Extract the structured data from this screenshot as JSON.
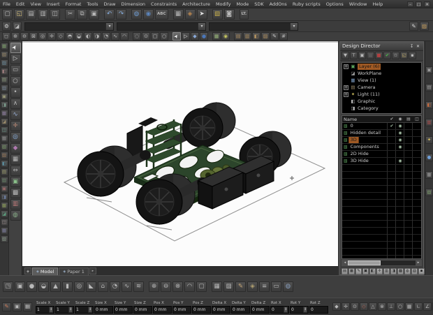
{
  "menu": {
    "items": [
      "File",
      "Edit",
      "View",
      "Insert",
      "Format",
      "Tools",
      "Draw",
      "Dimension",
      "Constraints",
      "Architecture",
      "Modify",
      "Mode",
      "SDK",
      "AddOns",
      "Ruby scripts",
      "Options",
      "Window",
      "Help"
    ]
  },
  "window_buttons": [
    {
      "n": "minimize-icon",
      "g": "–"
    },
    {
      "n": "maximize-icon",
      "g": "□"
    },
    {
      "n": "close-icon",
      "g": "✕"
    }
  ],
  "toolbar1": {
    "icons": [
      {
        "n": "new-icon",
        "g": "▢"
      },
      {
        "n": "open-icon",
        "g": "◱",
        "c": "#d8c27a"
      },
      {
        "n": "save-icon",
        "g": "▤"
      },
      {
        "n": "print-icon",
        "g": "▥"
      },
      {
        "n": "print-preview-icon",
        "g": "◫"
      },
      {
        "n": "cut-icon",
        "g": "✂",
        "sp": 1
      },
      {
        "n": "copy-icon",
        "g": "⧉"
      },
      {
        "n": "paste-icon",
        "g": "▣"
      },
      {
        "n": "undo-icon",
        "g": "↶",
        "c": "#8ab4e8",
        "sp": 1
      },
      {
        "n": "redo-icon",
        "g": "↷",
        "c": "#8ab4e8"
      },
      {
        "n": "render-icon",
        "g": "◍",
        "c": "#6f9fd8",
        "sp": 1
      },
      {
        "n": "lighting-icon",
        "g": "◉",
        "c": "#5b86c0"
      },
      {
        "n": "spell-check-icon",
        "g": "ABC",
        "cls": "wide"
      },
      {
        "n": "grid-icon",
        "g": "▦",
        "sp": 1
      },
      {
        "n": "material-icon",
        "g": "◈",
        "c": "#c08a50"
      },
      {
        "n": "pointer-icon",
        "g": "➤",
        "c": "#e8e8e8"
      },
      {
        "n": "library-icon",
        "g": "▧",
        "c": "#c8b04a",
        "sp": 1
      },
      {
        "n": "stamp-icon",
        "g": "◙"
      },
      {
        "n": "lite-mode-icon",
        "g": "LT.",
        "cls": "wide",
        "sp": 1
      }
    ]
  },
  "property_bar": {
    "combo_arrow": "▾",
    "left_icons": [
      {
        "n": "settings-gear-icon",
        "g": "⚙",
        "c": "#dcdcdc"
      },
      {
        "n": "workplane-icon",
        "g": "◪",
        "c": "#b8b8b8"
      }
    ],
    "combos": [
      {
        "n": "layer-combo",
        "value": ""
      },
      {
        "n": "pen-style-combo",
        "value": ""
      },
      {
        "n": "pen-width-combo",
        "value": ""
      }
    ],
    "right_icons": [
      {
        "n": "pen-icon",
        "g": "✎",
        "c": "#d8d8d8"
      },
      {
        "n": "material-preview-icon",
        "g": "▨",
        "c": "#c8a060"
      }
    ]
  },
  "view_toolbar": {
    "icons": [
      {
        "n": "zoom-window-icon",
        "g": "◻"
      },
      {
        "n": "zoom-in-icon",
        "g": "⊕"
      },
      {
        "n": "zoom-out-icon",
        "g": "⊖"
      },
      {
        "n": "zoom-extents-icon",
        "g": "⊠"
      },
      {
        "n": "zoom-previous-icon",
        "g": "◎"
      },
      {
        "n": "pan-icon",
        "g": "✛"
      },
      {
        "n": "view-iso-icon",
        "g": "◇"
      },
      {
        "n": "view-top-icon",
        "g": "◓"
      },
      {
        "n": "view-bottom-icon",
        "g": "◒"
      },
      {
        "n": "view-left-icon",
        "g": "◐"
      },
      {
        "n": "view-right-icon",
        "g": "◑"
      },
      {
        "n": "orbit-icon",
        "g": "◔"
      },
      {
        "n": "walk-icon",
        "g": "∿"
      },
      {
        "n": "camera-icon",
        "g": "◠"
      },
      {
        "n": "redline-icon",
        "g": "◌",
        "sp": 1
      },
      {
        "n": "markup-icon",
        "g": "⊙"
      },
      {
        "n": "frame-icon",
        "g": "▢"
      },
      {
        "n": "circle-view-icon",
        "g": "○"
      },
      {
        "n": "select-arrow-icon",
        "g": "➤",
        "c": "#ffffff",
        "cls": "hl cur",
        "sp": 1
      },
      {
        "n": "select-open-icon",
        "g": "▷",
        "c": "#e0e0e0"
      },
      {
        "n": "snap-vertex-icon",
        "g": "◆",
        "c": "#88a8d8"
      },
      {
        "n": "snap-center-icon",
        "g": "●",
        "c": "#4a76b8"
      },
      {
        "n": "snap-grid-icon",
        "g": "▦",
        "c": "#9ab87a",
        "sp": 1
      },
      {
        "n": "snap-quadrant-icon",
        "g": "◉",
        "c": "#c8c860"
      },
      {
        "n": "group-icon",
        "g": "▤",
        "c": "#b09060",
        "sp": 1
      },
      {
        "n": "explode-icon",
        "g": "▥",
        "c": "#b09060"
      },
      {
        "n": "block-icon",
        "g": "◧",
        "c": "#b09060"
      },
      {
        "n": "hatch-icon",
        "g": "▨",
        "c": "#b09060"
      },
      {
        "n": "sketch-icon",
        "g": "✎",
        "c": "#c8c8c8"
      },
      {
        "n": "measure-icon",
        "g": "#"
      }
    ]
  },
  "left_dock_a": {
    "icons": [
      {
        "g": "▦",
        "c": "#7a9a6a"
      },
      {
        "g": "▧",
        "c": "#9a8a6a"
      },
      {
        "g": "▨",
        "c": "#6a8a9a"
      },
      {
        "g": "◧",
        "c": "#9a7a7a"
      },
      {
        "g": "▤",
        "c": "#8a9a7a"
      },
      {
        "g": "▥",
        "c": "#7a8a9a"
      },
      {
        "g": "▣",
        "c": "#9a9a7a"
      },
      {
        "g": "◨",
        "c": "#7a9a8a"
      },
      {
        "g": "▩",
        "c": "#8a7a9a"
      },
      {
        "g": "◪",
        "c": "#9a8a6a"
      },
      {
        "g": "◫",
        "c": "#6a9a8a"
      },
      {
        "g": "▦",
        "c": "#8a8a8a"
      },
      {
        "g": "▧",
        "c": "#7a9a6a"
      },
      {
        "g": "▨",
        "c": "#9a7a5a"
      },
      {
        "g": "◧",
        "c": "#5a8a9a"
      },
      {
        "g": "▤",
        "c": "#9a9a6a"
      },
      {
        "g": "▥",
        "c": "#6a8a6a"
      },
      {
        "g": "▣",
        "c": "#9a6a6a"
      },
      {
        "g": "◨",
        "c": "#6a7a9a"
      },
      {
        "g": "▩",
        "c": "#8a9a5a"
      },
      {
        "g": "◪",
        "c": "#5a9a7a"
      },
      {
        "g": "◫",
        "c": "#9a8a8a"
      },
      {
        "g": "▦",
        "c": "#7a7a9a"
      },
      {
        "g": "▧",
        "c": "#8a9a8a"
      }
    ]
  },
  "left_tools": {
    "icons": [
      {
        "n": "select-tool-icon",
        "g": "➤",
        "c": "#f2f2f2",
        "cls": "hl cur"
      },
      {
        "n": "select-open-tool-icon",
        "g": "▷",
        "c": "#d8d8d8"
      },
      {
        "n": "rect-tool-icon",
        "g": "▭"
      },
      {
        "n": "circle-tool-icon",
        "g": "○"
      },
      {
        "n": "point-tool-icon",
        "g": "•"
      },
      {
        "n": "polyline-tool-icon",
        "g": "∧"
      },
      {
        "n": "spline-tool-icon",
        "g": "∿",
        "c": "#9ab0d8"
      },
      {
        "n": "pick-point-tool-icon",
        "g": "✛",
        "c": "#c8907a"
      },
      {
        "n": "orbit-tool-icon",
        "g": "◎",
        "c": "#8ab0e0"
      },
      {
        "n": "gem-tool-icon",
        "g": "◆",
        "c": "#b07ab0"
      },
      {
        "n": "grid-tool-icon",
        "g": "▦"
      },
      {
        "n": "resize-tool-icon",
        "g": "⇔"
      },
      {
        "n": "cube-tool-icon",
        "g": "▣",
        "c": "#8ac08a"
      },
      {
        "n": "pattern-tool-icon",
        "g": "▩"
      },
      {
        "n": "material-tool-icon",
        "g": "▥",
        "c": "#c07a7a"
      },
      {
        "n": "render-tool-icon",
        "g": "◍",
        "c": "#8ab08a"
      }
    ]
  },
  "right_dock": {
    "icons": [
      {
        "n": "properties-icon",
        "g": "▣",
        "c": "#9a9a9a"
      },
      {
        "n": "selection-info-icon",
        "g": "▤",
        "c": "#9a9a9a"
      },
      {
        "n": "blocks-icon",
        "g": "◧",
        "c": "#c06a40"
      },
      {
        "n": "library-palette-icon",
        "g": "▥",
        "c": "#b04a4a"
      },
      {
        "n": "lights-icon",
        "g": "✦",
        "c": "#d8c060"
      },
      {
        "n": "render-manager-icon",
        "g": "●",
        "c": "#6f9fd8"
      },
      {
        "n": "schedule-icon",
        "g": "▦",
        "c": "#9a9a9a"
      },
      {
        "n": "layers-palette-icon",
        "g": "▧",
        "c": "#7a9a6a"
      }
    ]
  },
  "design_director": {
    "title": "Design Director",
    "pin_glyph": "↧",
    "close_glyph": "✕",
    "toolbar_icons": [
      {
        "n": "dd-filter-icon",
        "g": "▼"
      },
      {
        "n": "dd-text-icon",
        "g": "T"
      },
      {
        "n": "dd-box-icon",
        "g": "▣"
      },
      {
        "n": "dd-dark-icon",
        "g": "■",
        "c": "#565656"
      },
      {
        "n": "dd-delete-icon",
        "g": "■",
        "c": "#b04040"
      },
      {
        "n": "dd-apply-check-icon",
        "g": "✔",
        "c": "#49c049"
      },
      {
        "n": "dd-blank-icon",
        "g": "▫"
      },
      {
        "n": "dd-folder-icon",
        "g": "◱",
        "c": "#d0b870"
      },
      {
        "n": "dd-props-icon",
        "g": "▪"
      }
    ],
    "tree": {
      "items": [
        {
          "exp": "+",
          "ig": "▣",
          "c": "#5aa05a",
          "label": "Layer (6)",
          "cls": "sel",
          "n": "tree-item-layer"
        },
        {
          "exp": "",
          "ig": "◪",
          "c": "#9a9a9a",
          "label": "WorkPlane",
          "n": "tree-item-workplane"
        },
        {
          "exp": "",
          "ig": "▦",
          "c": "#7a9ac0",
          "label": "View (1)",
          "n": "tree-item-view"
        },
        {
          "exp": "+",
          "ig": "▤",
          "c": "#9a8a6a",
          "label": "Camera",
          "n": "tree-item-camera"
        },
        {
          "exp": "+",
          "ig": "✦",
          "c": "#d0c060",
          "label": "Light (11)",
          "n": "tree-item-light"
        },
        {
          "exp": "",
          "ig": "◧",
          "c": "#b0b0b0",
          "label": "Graphic",
          "n": "tree-item-graphic"
        },
        {
          "exp": "",
          "ig": "◨",
          "c": "#b0b0b0",
          "label": "Category",
          "n": "tree-item-category"
        }
      ]
    },
    "table": {
      "name_header": "Name",
      "cols": [
        "✔",
        "◉",
        "▤",
        "◫"
      ],
      "rows": [
        {
          "ig": "▧",
          "c": "#5a9a5a",
          "name": "0",
          "chk": "✔",
          "eye": "◉"
        },
        {
          "ig": "▧",
          "c": "#5a9a5a",
          "name": "Hidden detail",
          "chk": "",
          "eye": "◉"
        },
        {
          "ig": "▧",
          "c": "#5a9a5a",
          "name": "3D",
          "chk": "",
          "eye": "◉",
          "cls": "sel"
        },
        {
          "ig": "▧",
          "c": "#5a9a5a",
          "name": "Components",
          "chk": "",
          "eye": "◉"
        },
        {
          "ig": "▧",
          "c": "#5a9a5a",
          "name": "2D Hide",
          "chk": "",
          "eye": ""
        },
        {
          "ig": "▧",
          "c": "#5a9a5a",
          "name": "3D Hide",
          "chk": "",
          "eye": "◉"
        }
      ]
    },
    "scroll": {
      "left": "◂",
      "right": "▸"
    },
    "bottom_icons": [
      {
        "g": "▤",
        "cls": "lt"
      },
      {
        "g": "▦",
        "cls": "lt"
      },
      {
        "g": "✎",
        "cls": "lt"
      },
      {
        "g": "▣",
        "cls": "lt"
      },
      {
        "g": "◧",
        "cls": "lt"
      },
      {
        "g": "✛",
        "cls": "lt"
      },
      {
        "g": "▥",
        "cls": "lt"
      },
      {
        "g": "◨",
        "cls": "lt"
      },
      {
        "g": "▩",
        "cls": "lt"
      },
      {
        "g": "◍",
        "cls": "lt"
      },
      {
        "g": "▧",
        "cls": "lt"
      },
      {
        "g": "▪",
        "cls": "lt"
      }
    ]
  },
  "tabs": {
    "nav_icon": "◈",
    "items": [
      {
        "icon": "◈",
        "label": "Model",
        "cls": "active",
        "n": "tab-model"
      },
      {
        "icon": "◈",
        "label": "Paper 1",
        "n": "tab-paper-1"
      }
    ],
    "overflow_icon": "▸"
  },
  "bottom_toolbar": {
    "icons": [
      {
        "n": "select-3d-icon",
        "g": "◳"
      },
      {
        "n": "box-3d-icon",
        "g": "▣"
      },
      {
        "n": "sphere-3d-icon",
        "g": "●"
      },
      {
        "n": "hemisphere-icon",
        "g": "◒"
      },
      {
        "n": "cone-icon",
        "g": "▲"
      },
      {
        "n": "cylinder-icon",
        "g": "▮"
      },
      {
        "n": "torus-icon",
        "g": "◎"
      },
      {
        "n": "wedge-icon",
        "g": "◣"
      },
      {
        "n": "prism-icon",
        "g": "⌂"
      },
      {
        "n": "revolve-icon",
        "g": "◔"
      },
      {
        "n": "sweep-icon",
        "g": "∿"
      },
      {
        "n": "loft-icon",
        "g": "≋"
      },
      {
        "n": "union-icon",
        "g": "⊕",
        "sp": 1
      },
      {
        "n": "subtract-icon",
        "g": "⊖"
      },
      {
        "n": "intersect-icon",
        "g": "⊗"
      },
      {
        "n": "fillet-3d-icon",
        "g": "◠"
      },
      {
        "n": "shell-icon",
        "g": "▢"
      },
      {
        "n": "facet-icon",
        "g": "▦",
        "sp": 1
      },
      {
        "n": "hatch-3d-icon",
        "g": "▨"
      },
      {
        "n": "edit-3d-icon",
        "g": "✎",
        "c": "#c8a878"
      },
      {
        "n": "material-3d-icon",
        "g": "◈",
        "c": "#b0a070"
      },
      {
        "n": "stack-icon",
        "g": "≡"
      },
      {
        "n": "plane-icon",
        "g": "▭"
      },
      {
        "n": "render-3d-icon",
        "g": "◍",
        "c": "#8aa0c0"
      }
    ]
  },
  "status_bar": {
    "spinner_glyph": "↕",
    "left_icons": [
      {
        "n": "edit-mode-icon",
        "g": "✎",
        "c": "#c87a5a"
      },
      {
        "n": "inspector-icon",
        "g": "▣"
      },
      {
        "n": "coord-grid-icon",
        "g": "▦"
      }
    ],
    "fields": [
      {
        "label": "Scale X",
        "value": "1",
        "cls": "spin"
      },
      {
        "label": "Scale Y",
        "value": "1",
        "cls": "spin"
      },
      {
        "label": "Scale Z",
        "value": "1",
        "cls": "spin"
      },
      {
        "label": "Size X",
        "value": "0 mm"
      },
      {
        "label": "Size Y",
        "value": "0 mm"
      },
      {
        "label": "Size Z",
        "value": "0 mm"
      },
      {
        "label": "Pos X",
        "value": "0 mm"
      },
      {
        "label": "Pos Y",
        "value": "0 mm"
      },
      {
        "label": "Pos Z",
        "value": "0 mm"
      },
      {
        "label": "Delta X",
        "value": "0 mm"
      },
      {
        "label": "Delta Y",
        "value": "0 mm"
      },
      {
        "label": "Delta Z",
        "value": "0 mm"
      },
      {
        "label": "Rot X",
        "value": "0",
        "cls": "spin"
      },
      {
        "label": "Rot Y",
        "value": "0",
        "cls": "spin"
      },
      {
        "label": "Rot Z",
        "value": "0"
      }
    ],
    "right_icons": [
      {
        "n": "snap-vertex-toggle-icon",
        "g": "◆"
      },
      {
        "n": "snap-nearest-toggle-icon",
        "g": "✛"
      },
      {
        "n": "snap-center-toggle-icon",
        "g": "⊙"
      },
      {
        "n": "snap-mid-toggle-icon",
        "g": "◇",
        "c": "#b06050"
      },
      {
        "n": "snap-quad-toggle-icon",
        "g": "△"
      },
      {
        "n": "snap-intersect-toggle-icon",
        "g": "⊗"
      },
      {
        "n": "snap-perp-toggle-icon",
        "g": "⊥"
      },
      {
        "n": "snap-tangent-toggle-icon",
        "g": "○"
      },
      {
        "n": "snap-grid-toggle-icon",
        "g": "▦"
      },
      {
        "n": "ortho-toggle-icon",
        "g": "∟"
      },
      {
        "n": "polar-toggle-icon",
        "g": "∠"
      },
      {
        "n": "dynamic-input-toggle-icon",
        "g": "▭"
      }
    ]
  }
}
